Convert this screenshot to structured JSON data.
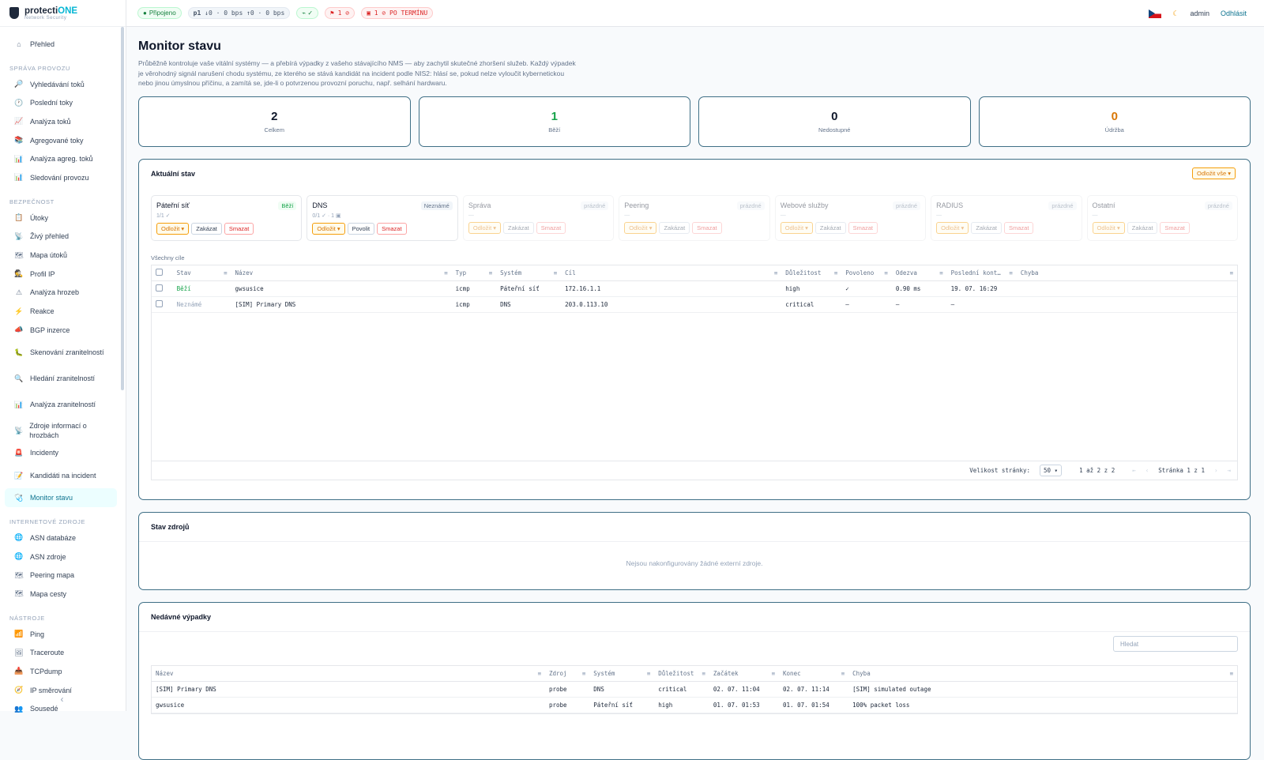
{
  "brand": {
    "name_a": "protecti",
    "name_b": "ONE",
    "tagline": "Network Security"
  },
  "topbar": {
    "status": "Připojeno",
    "profile": "p1",
    "rate": "↓0 · 0 bps ↑0 · 0 bps",
    "alerts": "⚑ 1 ⊘",
    "overdue": "▣ 1 ⊘ PO TERMÍNU",
    "user": "admin",
    "logout": "Odhlásit"
  },
  "nav": {
    "overview": "Přehled",
    "sec1": "SPRÁVA PROVOZU",
    "s1": [
      "Vyhledávání toků",
      "Poslední toky",
      "Analýza toků",
      "Agregované toky",
      "Analýza agreg. toků",
      "Sledování provozu"
    ],
    "sec2": "BEZPEČNOST",
    "s2": [
      "Útoky",
      "Živý přehled",
      "Mapa útoků",
      "Profil IP",
      "Analýza hrozeb",
      "Reakce",
      "BGP inzerce",
      "Skenování zranitelností",
      "Hledání zranitelností",
      "Analýza zranitelností",
      "Zdroje informací o hrozbách",
      "Incidenty",
      "Kandidáti na incident",
      "Monitor stavu"
    ],
    "sec3": "INTERNETOVÉ ZDROJE",
    "s3": [
      "ASN databáze",
      "ASN zdroje",
      "Peering mapa",
      "Mapa cesty"
    ],
    "sec4": "NÁSTROJE",
    "s4": [
      "Ping",
      "Traceroute",
      "TCPdump",
      "IP směrování",
      "Sousedé"
    ]
  },
  "page": {
    "title": "Monitor stavu",
    "desc": "Průběžně kontroluje vaše vitální systémy — a přebírá výpadky z vašeho stávajícího NMS — aby zachytil skutečné zhoršení služeb. Každý výpadek je věrohodný signál narušení chodu systému, ze kterého se stává kandidát na incident podle NIS2: hlásí se, pokud nelze vyloučit kybernetickou nebo jinou úmyslnou příčinu, a zamítá se, jde-li o potvrzenou provozní poruchu, např. selhání hardwaru."
  },
  "stats": [
    {
      "v": "2",
      "l": "Celkem",
      "c": "#0f172a"
    },
    {
      "v": "1",
      "l": "Běží",
      "c": "#16a34a"
    },
    {
      "v": "0",
      "l": "Nedostupné",
      "c": "#0f172a"
    },
    {
      "v": "0",
      "l": "Údržba",
      "c": "#d97706"
    }
  ],
  "current": {
    "title": "Aktuální stav",
    "snooze_all": "Odložit vše ▾",
    "all_targets": "Všechny cíle"
  },
  "groups": [
    {
      "name": "Páteřní síť",
      "tag": "Běží",
      "count": "1/1 ✓",
      "b2": "Zakázat"
    },
    {
      "name": "DNS",
      "tag": "Neznámé",
      "count": "0/1 ✓ · 1 ▣",
      "b2": "Povolit"
    },
    {
      "name": "Správa",
      "tag": "prázdné",
      "count": "—",
      "b2": "Zakázat"
    },
    {
      "name": "Peering",
      "tag": "prázdné",
      "count": "—",
      "b2": "Zakázat"
    },
    {
      "name": "Webové služby",
      "tag": "prázdné",
      "count": "—",
      "b2": "Zakázat"
    },
    {
      "name": "RADIUS",
      "tag": "prázdné",
      "count": "—",
      "b2": "Zakázat"
    },
    {
      "name": "Ostatní",
      "tag": "prázdné",
      "count": "—",
      "b2": "Zakázat"
    }
  ],
  "btn": {
    "snooze": "Odložit ▾",
    "delete": "Smazat"
  },
  "targets": {
    "cols": [
      "Stav",
      "Název",
      "Typ",
      "Systém",
      "Cíl",
      "Důležitost",
      "Povoleno",
      "Odezva",
      "Poslední kont…",
      "Chyba"
    ],
    "rows": [
      [
        "Běží",
        "gwsusice",
        "icmp",
        "Páteřní síť",
        "172.16.1.1",
        "high",
        "✓",
        "0.90 ms",
        "19. 07. 16:29",
        ""
      ],
      [
        "Neznámé",
        "[SIM] Primary DNS",
        "icmp",
        "DNS",
        "203.0.113.10",
        "critical",
        "—",
        "—",
        "—",
        ""
      ]
    ]
  },
  "pager": {
    "size_label": "Velikost stránky:",
    "size": "50",
    "range": "1 až 2 z 2",
    "page": "Stránka 1 z 1"
  },
  "sources": {
    "title": "Stav zdrojů",
    "empty": "Nejsou nakonfigurovány žádné externí zdroje."
  },
  "outages": {
    "title": "Nedávné výpadky",
    "search": "Hledat",
    "cols": [
      "Název",
      "Zdroj",
      "Systém",
      "Důležitost",
      "Začátek",
      "Konec",
      "Chyba"
    ],
    "rows": [
      [
        "[SIM] Primary DNS",
        "probe",
        "DNS",
        "critical",
        "02. 07. 11:04",
        "02. 07. 11:14",
        "[SIM] simulated outage"
      ],
      [
        "gwsusice",
        "probe",
        "Páteřní síť",
        "high",
        "01. 07. 01:53",
        "01. 07. 01:54",
        "100% packet loss"
      ]
    ]
  }
}
